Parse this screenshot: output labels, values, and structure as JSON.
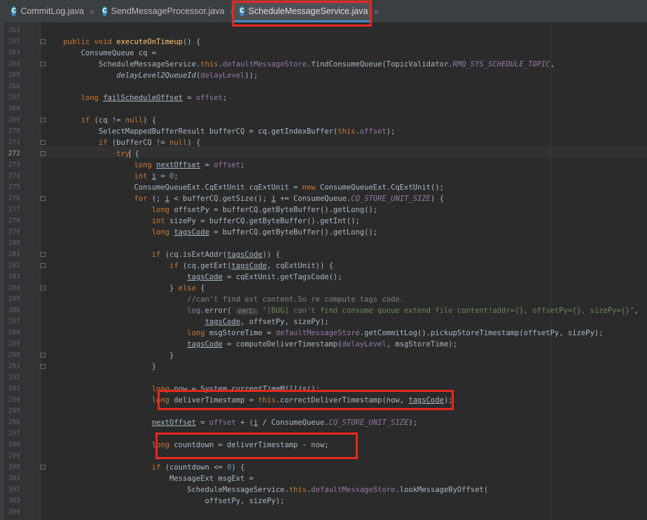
{
  "tabs": [
    {
      "label": "CommitLog.java",
      "icon": "C",
      "close": "×",
      "active": false
    },
    {
      "label": "SendMessageProcessor.java",
      "icon": "C",
      "close": "×",
      "active": false
    },
    {
      "label": "ScheduleMessageService.java",
      "icon": "C",
      "close": "×",
      "active": true
    }
  ],
  "editor": {
    "current_line": "272",
    "lines": [
      {
        "n": "261",
        "t": []
      },
      {
        "n": "262",
        "t": [
          [
            "    "
          ],
          [
            "public void ",
            "kw"
          ],
          [
            "executeOnTimeup",
            "fn"
          ],
          [
            "() {"
          ]
        ]
      },
      {
        "n": "263",
        "t": [
          [
            "        ConsumeQueue cq ="
          ]
        ]
      },
      {
        "n": "264",
        "t": [
          [
            "            ScheduleMessageService."
          ],
          [
            "this",
            "kw"
          ],
          [
            "."
          ],
          [
            "defaultMessageStore",
            "fld"
          ],
          [
            ".findConsumeQueue(TopicValidator."
          ],
          [
            "RMQ_SYS_SCHEDULE_TOPIC",
            "cst"
          ],
          [
            ","
          ]
        ]
      },
      {
        "n": "265",
        "t": [
          [
            "                "
          ],
          [
            "delayLevel2QueueId",
            "stf"
          ],
          [
            "("
          ],
          [
            "delayLevel",
            "fld"
          ],
          [
            "));"
          ]
        ]
      },
      {
        "n": "266",
        "t": []
      },
      {
        "n": "267",
        "t": [
          [
            "        "
          ],
          [
            "long ",
            "kw"
          ],
          [
            "failScheduleOffset",
            "ul"
          ],
          [
            " = "
          ],
          [
            "offset",
            "fld"
          ],
          [
            ";"
          ]
        ]
      },
      {
        "n": "268",
        "t": []
      },
      {
        "n": "269",
        "t": [
          [
            "        "
          ],
          [
            "if ",
            "kw"
          ],
          [
            "(cq != "
          ],
          [
            "null",
            "kw"
          ],
          [
            ") {"
          ]
        ]
      },
      {
        "n": "270",
        "t": [
          [
            "            SelectMappedBufferResult bufferCQ = cq.getIndexBuffer("
          ],
          [
            "this",
            "kw"
          ],
          [
            "."
          ],
          [
            "offset",
            "fld"
          ],
          [
            ");"
          ]
        ]
      },
      {
        "n": "271",
        "t": [
          [
            "            "
          ],
          [
            "if ",
            "kw"
          ],
          [
            "(bufferCQ != "
          ],
          [
            "null",
            "kw"
          ],
          [
            ") {"
          ]
        ]
      },
      {
        "n": "272",
        "t": [
          [
            "                "
          ],
          [
            "try",
            "kw"
          ],
          [
            "",
            "caret"
          ],
          [
            " {"
          ]
        ]
      },
      {
        "n": "273",
        "t": [
          [
            "                    "
          ],
          [
            "long ",
            "kw"
          ],
          [
            "nextOffset",
            "ul"
          ],
          [
            " = "
          ],
          [
            "offset",
            "fld"
          ],
          [
            ";"
          ]
        ]
      },
      {
        "n": "274",
        "t": [
          [
            "                    "
          ],
          [
            "int ",
            "kw"
          ],
          [
            "i",
            "ul"
          ],
          [
            " = "
          ],
          [
            "0",
            "num"
          ],
          [
            ";"
          ]
        ]
      },
      {
        "n": "275",
        "t": [
          [
            "                    ConsumeQueueExt.CqExtUnit cqExtUnit = "
          ],
          [
            "new ",
            "kw"
          ],
          [
            "ConsumeQueueExt.CqExtUnit();"
          ]
        ]
      },
      {
        "n": "276",
        "t": [
          [
            "                    "
          ],
          [
            "for ",
            "kw"
          ],
          [
            "(; "
          ],
          [
            "i",
            "ul"
          ],
          [
            " < bufferCQ.getSize(); "
          ],
          [
            "i",
            "ul"
          ],
          [
            " += ConsumeQueue."
          ],
          [
            "CQ_STORE_UNIT_SIZE",
            "cst"
          ],
          [
            ") {"
          ]
        ]
      },
      {
        "n": "277",
        "t": [
          [
            "                        "
          ],
          [
            "long ",
            "kw"
          ],
          [
            "offsetPy = bufferCQ.getByteBuffer().getLong();"
          ]
        ]
      },
      {
        "n": "278",
        "t": [
          [
            "                        "
          ],
          [
            "int ",
            "kw"
          ],
          [
            "sizePy = bufferCQ.getByteBuffer().getInt();"
          ]
        ]
      },
      {
        "n": "279",
        "t": [
          [
            "                        "
          ],
          [
            "long ",
            "kw"
          ],
          [
            "tagsCode",
            "ul"
          ],
          [
            " = bufferCQ.getByteBuffer().getLong();"
          ]
        ]
      },
      {
        "n": "280",
        "t": []
      },
      {
        "n": "281",
        "t": [
          [
            "                        "
          ],
          [
            "if ",
            "kw"
          ],
          [
            "(cq.isExtAddr("
          ],
          [
            "tagsCode",
            "ul"
          ],
          [
            ")) {"
          ]
        ]
      },
      {
        "n": "282",
        "t": [
          [
            "                            "
          ],
          [
            "if ",
            "kw"
          ],
          [
            "(cq.getExt("
          ],
          [
            "tagsCode",
            "ul"
          ],
          [
            ", cqExtUnit)) {"
          ]
        ]
      },
      {
        "n": "283",
        "t": [
          [
            "                                "
          ],
          [
            "tagsCode",
            "ul"
          ],
          [
            " = cqExtUnit.getTagsCode();"
          ]
        ]
      },
      {
        "n": "284",
        "t": [
          [
            "                            } "
          ],
          [
            "else ",
            "kw"
          ],
          [
            "{"
          ]
        ]
      },
      {
        "n": "285",
        "t": [
          [
            "                                "
          ],
          [
            "//can't find ext content.So re compute tags code.",
            "cmt"
          ]
        ]
      },
      {
        "n": "286",
        "t": [
          [
            "                                "
          ],
          [
            "log",
            "fld"
          ],
          [
            ".error( "
          ],
          [
            "var1:",
            "hint"
          ],
          [
            " "
          ],
          [
            "\"[BUG] can't find consume queue extend file content!addr={}, offsetPy={}, sizePy={}\"",
            "str"
          ],
          [
            ","
          ]
        ]
      },
      {
        "n": "287",
        "t": [
          [
            "                                    "
          ],
          [
            "tagsCode",
            "ul"
          ],
          [
            ", offsetPy, sizePy);"
          ]
        ]
      },
      {
        "n": "288",
        "t": [
          [
            "                                "
          ],
          [
            "long ",
            "kw"
          ],
          [
            "msgStoreTime = "
          ],
          [
            "defaultMessageStore",
            "fld"
          ],
          [
            ".getCommitLog().pickupStoreTimestamp(offsetPy, sizePy);"
          ]
        ]
      },
      {
        "n": "289",
        "t": [
          [
            "                                "
          ],
          [
            "tagsCode",
            "ul"
          ],
          [
            " = computeDeliverTimestamp("
          ],
          [
            "delayLevel",
            "fld"
          ],
          [
            ", msgStoreTime);"
          ]
        ]
      },
      {
        "n": "290",
        "t": [
          [
            "                            }"
          ]
        ]
      },
      {
        "n": "291",
        "t": [
          [
            "                        }"
          ]
        ]
      },
      {
        "n": "292",
        "t": []
      },
      {
        "n": "293",
        "t": [
          [
            "                        "
          ],
          [
            "long ",
            "kw"
          ],
          [
            "now = System."
          ],
          [
            "currentTimeMillis",
            "stf"
          ],
          [
            "();"
          ]
        ]
      },
      {
        "n": "294",
        "t": [
          [
            "                        "
          ],
          [
            "long ",
            "kw"
          ],
          [
            "deliverTimestamp = "
          ],
          [
            "this",
            "kw"
          ],
          [
            ".correctDeliverTimestamp(now, "
          ],
          [
            "tagsCode",
            "ul"
          ],
          [
            ");"
          ]
        ]
      },
      {
        "n": "295",
        "t": []
      },
      {
        "n": "296",
        "t": [
          [
            "                        "
          ],
          [
            "nextOffset",
            "ul"
          ],
          [
            " = "
          ],
          [
            "offset",
            "fld"
          ],
          [
            " + ("
          ],
          [
            "i",
            "ul"
          ],
          [
            " / ConsumeQueue."
          ],
          [
            "CQ_STORE_UNIT_SIZE",
            "cst"
          ],
          [
            ");"
          ]
        ]
      },
      {
        "n": "297",
        "t": []
      },
      {
        "n": "298",
        "t": [
          [
            "                        "
          ],
          [
            "long ",
            "kw"
          ],
          [
            "countdown = deliverTimestamp - now;"
          ]
        ]
      },
      {
        "n": "299",
        "t": []
      },
      {
        "n": "300",
        "t": [
          [
            "                        "
          ],
          [
            "if ",
            "kw"
          ],
          [
            "(countdown <= "
          ],
          [
            "0",
            "num"
          ],
          [
            ") {"
          ]
        ]
      },
      {
        "n": "301",
        "t": [
          [
            "                            MessageExt msgExt ="
          ]
        ]
      },
      {
        "n": "302",
        "t": [
          [
            "                                ScheduleMessageService."
          ],
          [
            "this",
            "kw"
          ],
          [
            "."
          ],
          [
            "defaultMessageStore",
            "fld"
          ],
          [
            ".lookMessageByOffset("
          ]
        ]
      },
      {
        "n": "303",
        "t": [
          [
            "                                    offsetPy, sizePy);"
          ]
        ]
      },
      {
        "n": "304",
        "t": []
      }
    ]
  }
}
